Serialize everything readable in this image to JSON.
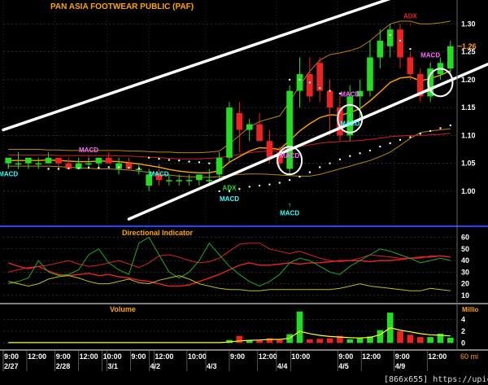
{
  "title": "PAN ASIA FOOTWEAR PUBLIC (PAF)",
  "watermark": "[866x655] https://upic.me/",
  "colors": {
    "background": "#000000",
    "up": "#22dd22",
    "down": "#ee2222",
    "ema_short": "#ffa500",
    "band": "#b8860b",
    "band_mid": "#cc2222",
    "sar": "#ffffff",
    "trend": "#ffffff",
    "macd_label": "#ff66ff",
    "macd_label_alt": "#33ffff",
    "adx_label": "#22dd22",
    "panel_label": "#ffa500",
    "divider": "#2244ff",
    "grid": "#555555",
    "di_plus": "#22aa22",
    "di_minus": "#dd2222",
    "adx": "#bbbb22",
    "vol_ma": "#ffff33",
    "axis_text": "#ffffff"
  },
  "chart_data": [
    {
      "type": "candlestick",
      "panel": "price",
      "title": "PAN ASIA FOOTWEAR PUBLIC (PAF)",
      "ylim": [
        0.94,
        1.34
      ],
      "yticks": [
        "1.00",
        "1.05",
        "1.10",
        "1.15",
        "1.20",
        "1.25",
        "1.30"
      ],
      "last_price_label": "1.26",
      "candles": [
        {
          "o": 1.05,
          "h": 1.06,
          "l": 1.04,
          "c": 1.06
        },
        {
          "o": 1.05,
          "h": 1.07,
          "l": 1.04,
          "c": 1.05
        },
        {
          "o": 1.05,
          "h": 1.06,
          "l": 1.04,
          "c": 1.06
        },
        {
          "o": 1.05,
          "h": 1.06,
          "l": 1.04,
          "c": 1.05
        },
        {
          "o": 1.05,
          "h": 1.07,
          "l": 1.05,
          "c": 1.06
        },
        {
          "o": 1.06,
          "h": 1.06,
          "l": 1.04,
          "c": 1.05
        },
        {
          "o": 1.05,
          "h": 1.06,
          "l": 1.04,
          "c": 1.04
        },
        {
          "o": 1.04,
          "h": 1.06,
          "l": 1.04,
          "c": 1.05
        },
        {
          "o": 1.05,
          "h": 1.06,
          "l": 1.04,
          "c": 1.05
        },
        {
          "o": 1.05,
          "h": 1.06,
          "l": 1.04,
          "c": 1.06
        },
        {
          "o": 1.06,
          "h": 1.07,
          "l": 1.05,
          "c": 1.05
        },
        {
          "o": 1.04,
          "h": 1.06,
          "l": 1.03,
          "c": 1.05
        },
        {
          "o": 1.05,
          "h": 1.06,
          "l": 1.04,
          "c": 1.04
        },
        {
          "o": 1.04,
          "h": 1.05,
          "l": 1.03,
          "c": 1.04
        },
        {
          "o": 1.01,
          "h": 1.04,
          "l": 1.0,
          "c": 1.03
        },
        {
          "o": 1.03,
          "h": 1.04,
          "l": 1.01,
          "c": 1.02
        },
        {
          "o": 1.02,
          "h": 1.03,
          "l": 1.01,
          "c": 1.02
        },
        {
          "o": 1.02,
          "h": 1.03,
          "l": 1.01,
          "c": 1.02
        },
        {
          "o": 1.02,
          "h": 1.03,
          "l": 1.01,
          "c": 1.02
        },
        {
          "o": 1.02,
          "h": 1.03,
          "l": 1.01,
          "c": 1.03
        },
        {
          "o": 1.02,
          "h": 1.04,
          "l": 1.01,
          "c": 1.02
        },
        {
          "o": 1.03,
          "h": 1.07,
          "l": 1.02,
          "c": 1.06
        },
        {
          "o": 1.06,
          "h": 1.16,
          "l": 1.05,
          "c": 1.15
        },
        {
          "o": 1.14,
          "h": 1.16,
          "l": 1.07,
          "c": 1.11
        },
        {
          "o": 1.11,
          "h": 1.13,
          "l": 1.09,
          "c": 1.12
        },
        {
          "o": 1.12,
          "h": 1.14,
          "l": 1.09,
          "c": 1.09
        },
        {
          "o": 1.09,
          "h": 1.11,
          "l": 1.05,
          "c": 1.06
        },
        {
          "o": 1.07,
          "h": 1.08,
          "l": 1.04,
          "c": 1.05
        },
        {
          "o": 1.04,
          "h": 1.19,
          "l": 1.03,
          "c": 1.18
        },
        {
          "o": 1.18,
          "h": 1.24,
          "l": 1.15,
          "c": 1.21
        },
        {
          "o": 1.21,
          "h": 1.24,
          "l": 1.16,
          "c": 1.17
        },
        {
          "o": 1.23,
          "h": 1.24,
          "l": 1.16,
          "c": 1.18
        },
        {
          "o": 1.18,
          "h": 1.2,
          "l": 1.1,
          "c": 1.15
        },
        {
          "o": 1.15,
          "h": 1.17,
          "l": 1.09,
          "c": 1.1
        },
        {
          "o": 1.1,
          "h": 1.19,
          "l": 1.09,
          "c": 1.17
        },
        {
          "o": 1.17,
          "h": 1.2,
          "l": 1.13,
          "c": 1.18
        },
        {
          "o": 1.18,
          "h": 1.27,
          "l": 1.17,
          "c": 1.24
        },
        {
          "o": 1.24,
          "h": 1.29,
          "l": 1.22,
          "c": 1.27
        },
        {
          "o": 1.26,
          "h": 1.3,
          "l": 1.24,
          "c": 1.29
        },
        {
          "o": 1.29,
          "h": 1.3,
          "l": 1.22,
          "c": 1.24
        },
        {
          "o": 1.24,
          "h": 1.25,
          "l": 1.2,
          "c": 1.21
        },
        {
          "o": 1.21,
          "h": 1.22,
          "l": 1.16,
          "c": 1.17
        },
        {
          "o": 1.17,
          "h": 1.23,
          "l": 1.16,
          "c": 1.22
        },
        {
          "o": 1.21,
          "h": 1.24,
          "l": 1.2,
          "c": 1.23
        },
        {
          "o": 1.22,
          "h": 1.27,
          "l": 1.21,
          "c": 1.26
        }
      ],
      "ema_short": [
        1.055,
        1.055,
        1.055,
        1.055,
        1.056,
        1.055,
        1.054,
        1.053,
        1.053,
        1.054,
        1.054,
        1.053,
        1.051,
        1.049,
        1.046,
        1.043,
        1.039,
        1.036,
        1.034,
        1.033,
        1.033,
        1.037,
        1.052,
        1.062,
        1.072,
        1.078,
        1.077,
        1.075,
        1.091,
        1.108,
        1.121,
        1.132,
        1.137,
        1.136,
        1.141,
        1.148,
        1.162,
        1.178,
        1.195,
        1.203,
        1.205,
        1.198,
        1.202,
        1.208,
        1.216
      ],
      "band_upper": [
        1.075,
        1.075,
        1.075,
        1.075,
        1.074,
        1.074,
        1.073,
        1.073,
        1.073,
        1.073,
        1.073,
        1.073,
        1.072,
        1.072,
        1.071,
        1.07,
        1.07,
        1.069,
        1.069,
        1.069,
        1.07,
        1.072,
        1.085,
        1.1,
        1.115,
        1.125,
        1.13,
        1.135,
        1.16,
        1.19,
        1.215,
        1.235,
        1.245,
        1.248,
        1.252,
        1.258,
        1.27,
        1.285,
        1.3,
        1.305,
        1.305,
        1.3,
        1.3,
        1.302,
        1.305
      ],
      "band_mid": [
        1.065,
        1.065,
        1.065,
        1.065,
        1.065,
        1.064,
        1.064,
        1.064,
        1.064,
        1.064,
        1.064,
        1.063,
        1.063,
        1.062,
        1.061,
        1.06,
        1.059,
        1.058,
        1.058,
        1.058,
        1.059,
        1.06,
        1.063,
        1.066,
        1.069,
        1.071,
        1.072,
        1.073,
        1.076,
        1.08,
        1.083,
        1.086,
        1.088,
        1.089,
        1.09,
        1.091,
        1.093,
        1.095,
        1.098,
        1.099,
        1.1,
        1.1,
        1.101,
        1.102,
        1.104
      ],
      "band_lower": [
        1.045,
        1.045,
        1.045,
        1.045,
        1.045,
        1.044,
        1.043,
        1.042,
        1.041,
        1.04,
        1.04,
        1.039,
        1.038,
        1.036,
        1.034,
        1.031,
        1.029,
        1.027,
        1.026,
        1.025,
        1.025,
        1.026,
        1.028,
        1.03,
        1.031,
        1.031,
        1.03,
        1.029,
        1.028,
        1.027,
        1.027,
        1.03,
        1.035,
        1.04,
        1.045,
        1.05,
        1.055,
        1.062,
        1.07,
        1.082,
        1.095,
        1.105,
        1.108,
        1.11,
        1.112
      ],
      "sar": [
        null,
        null,
        null,
        null,
        1.04,
        1.04,
        1.041,
        1.041,
        1.042,
        1.042,
        1.043,
        1.043,
        1.042,
        1.041,
        1.06,
        1.058,
        1.056,
        1.055,
        1.053,
        1.052,
        1.05,
        1.0,
        1.0,
        1.004,
        1.008,
        1.01,
        1.012,
        1.015,
        1.02,
        1.026,
        1.034,
        1.043,
        1.05,
        1.057,
        1.063,
        1.068,
        1.073,
        1.08,
        1.086,
        1.092,
        1.097,
        1.103,
        1.108,
        1.113,
        1.118
      ],
      "sar_top": [
        {
          "i": 28,
          "v": 1.2
        },
        {
          "i": 29,
          "v": 1.2
        },
        {
          "i": 30,
          "v": 1.195
        },
        {
          "i": 31,
          "v": 1.185
        },
        {
          "i": 32,
          "v": 1.18
        },
        {
          "i": 33,
          "v": 1.175
        },
        {
          "i": 38,
          "v": 1.28
        },
        {
          "i": 39,
          "v": 1.27
        },
        {
          "i": 40,
          "v": 1.255
        }
      ],
      "trendlines": [
        {
          "x1": -0.5,
          "v1": 1.11,
          "x2": 44.5,
          "v2": 1.385
        },
        {
          "x1": 12,
          "v1": 0.95,
          "x2": 48,
          "v2": 1.23
        }
      ],
      "circles": [
        {
          "i": 28,
          "v": 1.055
        },
        {
          "i": 34,
          "v": 1.13
        },
        {
          "i": 43,
          "v": 1.195
        }
      ],
      "signals": [
        {
          "text": "MACD",
          "i": 0,
          "v": 1.03,
          "arrow": "up",
          "color": "cyan"
        },
        {
          "text": "MACD",
          "i": 8,
          "v": 1.07,
          "arrow": "down",
          "color": "magenta"
        },
        {
          "text": "MACD",
          "i": 15,
          "v": 1.03,
          "arrow": "up",
          "color": "cyan"
        },
        {
          "text": "MACD",
          "i": 22,
          "v": 0.985,
          "arrow": "up",
          "color": "cyan"
        },
        {
          "text": "ADX",
          "i": 22,
          "v": 1.005,
          "arrow": "none",
          "color": "green"
        },
        {
          "text": "MACD",
          "i": 28,
          "v": 1.06,
          "arrow": "down",
          "color": "magenta"
        },
        {
          "text": "MACD",
          "i": 28,
          "v": 0.96,
          "arrow": "up",
          "color": "cyan"
        },
        {
          "text": "MACD",
          "i": 34,
          "v": 1.12,
          "arrow": "up",
          "color": "cyan"
        },
        {
          "text": "MACD",
          "i": 34,
          "v": 1.17,
          "arrow": "down",
          "color": "magenta"
        },
        {
          "text": "ADX",
          "i": 40,
          "v": 1.31,
          "arrow": "down",
          "color": "red"
        },
        {
          "text": "MACD",
          "i": 42,
          "v": 1.24,
          "arrow": "down",
          "color": "magenta"
        }
      ]
    },
    {
      "type": "line",
      "panel": "directional",
      "title": "Directional Indicator",
      "ylim": [
        5,
        66
      ],
      "yticks": [
        "10",
        "20",
        "30",
        "40",
        "50",
        "60"
      ],
      "series": [
        {
          "values": [
            30,
            32,
            34,
            35,
            36,
            38,
            40,
            37,
            35,
            36,
            38,
            40,
            37,
            34,
            38,
            44,
            45,
            43,
            40,
            38,
            39,
            42,
            48,
            54,
            55,
            55,
            50,
            48,
            46,
            48,
            45,
            42,
            40,
            39,
            40,
            42,
            45,
            44,
            43,
            42,
            42,
            42,
            44,
            44,
            43
          ]
        },
        {
          "values": [
            38,
            35,
            33,
            35,
            31,
            28,
            27,
            28,
            29,
            27,
            28,
            26,
            25,
            23,
            22,
            20,
            18,
            18,
            19,
            22,
            25,
            28,
            32,
            36,
            38,
            36,
            36,
            37,
            38,
            37,
            38,
            38,
            39,
            40,
            40,
            40,
            39,
            40,
            40,
            41,
            42,
            43,
            43,
            44,
            43
          ]
        },
        {
          "values": [
            20,
            22,
            25,
            40,
            30,
            27,
            28,
            32,
            45,
            50,
            38,
            32,
            28,
            55,
            60,
            45,
            30,
            25,
            30,
            40,
            55,
            45,
            35,
            28,
            22,
            18,
            22,
            28,
            38,
            42,
            40,
            35,
            30,
            28,
            35,
            40,
            45,
            50,
            48,
            45,
            42,
            38,
            40,
            42,
            40
          ]
        },
        {
          "values": [
            22,
            20,
            18,
            20,
            24,
            26,
            27,
            25,
            22,
            20,
            20,
            22,
            24,
            21,
            20,
            23,
            25,
            27,
            24,
            20,
            18,
            16,
            15,
            15,
            14,
            14,
            15,
            15,
            15,
            15,
            15,
            15,
            15,
            16,
            18,
            20,
            18,
            17,
            16,
            15,
            14,
            14,
            16,
            15,
            14
          ]
        }
      ]
    },
    {
      "type": "bar",
      "panel": "volume",
      "title": "Volume",
      "unit_label": "Millio",
      "ylim": [
        -0.8,
        6.2
      ],
      "yticks": [
        "0",
        "2",
        "4"
      ],
      "values": [
        0,
        0,
        0,
        0,
        0,
        0,
        0,
        0,
        0,
        0,
        0,
        0,
        0,
        0,
        0,
        0,
        0,
        0,
        0,
        0,
        0,
        0,
        0.5,
        1.2,
        0.4,
        0.5,
        0.8,
        0.5,
        1.5,
        5.4,
        0.6,
        0.7,
        0.8,
        1.2,
        0.6,
        0.8,
        1.1,
        2.2,
        5.2,
        2.0,
        1.4,
        1.0,
        1.0,
        1.6,
        0.9
      ],
      "vol_ma": [
        0.05,
        0.05,
        0.05,
        0.05,
        0.05,
        0.05,
        0.05,
        0.05,
        0.05,
        0.05,
        0.05,
        0.05,
        0.05,
        0.05,
        0.05,
        0.05,
        0.05,
        0.05,
        0.05,
        0.05,
        0.05,
        0.05,
        0.15,
        0.35,
        0.45,
        0.5,
        0.6,
        0.6,
        0.8,
        2.0,
        1.6,
        1.3,
        1.1,
        1.0,
        0.9,
        0.85,
        0.95,
        1.4,
        2.6,
        2.2,
        1.9,
        1.6,
        1.4,
        1.3,
        1.2
      ]
    }
  ],
  "x_axis": {
    "labels": [
      {
        "text": "9:00",
        "i": 0,
        "row": 1
      },
      {
        "text": "12:00",
        "i": 5,
        "row": 1
      },
      {
        "text": "9:00",
        "i": 11,
        "row": 1
      },
      {
        "text": "12:00",
        "i": 16,
        "row": 1
      },
      {
        "text": "10:00",
        "i": 21,
        "row": 1
      },
      {
        "text": "9:00",
        "i": 27,
        "row": 1
      },
      {
        "text": "12:00",
        "i": 32,
        "row": 1
      },
      {
        "text": "10:00",
        "i": 39,
        "row": 1
      },
      {
        "text": "9:00",
        "i": 48,
        "row": 1
      },
      {
        "text": "12:00",
        "i": 54,
        "row": 1
      },
      {
        "text": "10:00",
        "i": 61,
        "row": 1
      },
      {
        "text": "9:00",
        "i": 71,
        "row": 1
      },
      {
        "text": "12:00",
        "i": 76,
        "row": 1
      },
      {
        "text": "9:00",
        "i": 83,
        "row": 1
      },
      {
        "text": "12:00",
        "i": 90,
        "row": 1
      },
      {
        "text": "2/27",
        "i": 0,
        "row": 2
      },
      {
        "text": "2/28",
        "i": 11,
        "row": 2
      },
      {
        "text": "3/1",
        "i": 22,
        "row": 2
      },
      {
        "text": "4/2",
        "i": 31,
        "row": 2
      },
      {
        "text": "4/3",
        "i": 43,
        "row": 2
      },
      {
        "text": "4/4",
        "i": 58,
        "row": 2
      },
      {
        "text": "4/5",
        "i": 71,
        "row": 2
      },
      {
        "text": "4/9",
        "i": 83,
        "row": 2
      }
    ],
    "trailing_label": "60 mi"
  }
}
